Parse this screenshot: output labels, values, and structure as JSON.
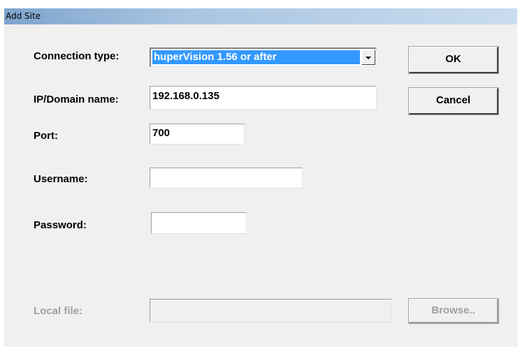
{
  "window": {
    "title": "Add Site"
  },
  "form": {
    "connection_type": {
      "label": "Connection type:",
      "value": "huperVision 1.56 or after"
    },
    "ip": {
      "label": "IP/Domain name:",
      "value": "192.168.0.135"
    },
    "port": {
      "label": "Port:",
      "value": "700"
    },
    "username": {
      "label": "Username:",
      "value": ""
    },
    "password": {
      "label": "Password:",
      "value": ""
    },
    "local_file": {
      "label": "Local file:",
      "value": ""
    }
  },
  "buttons": {
    "ok": "OK",
    "cancel": "Cancel",
    "browse": "Browse.."
  }
}
